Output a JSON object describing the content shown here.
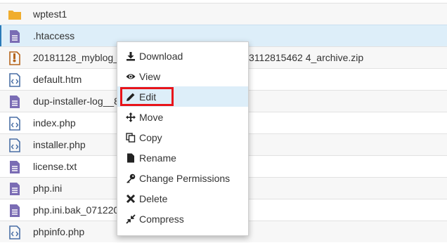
{
  "files": [
    {
      "name": "wptest1",
      "icon": "folder-icon"
    },
    {
      "name": ".htaccess",
      "icon": "text-file-icon"
    },
    {
      "name": "20181128_myblog_",
      "suffix": "3112815462 4_archive.zip",
      "icon": "zip-file-icon"
    },
    {
      "name": "default.htm",
      "icon": "code-file-icon"
    },
    {
      "name": "dup-installer-log__8",
      "icon": "text-file-icon"
    },
    {
      "name": "index.php",
      "icon": "code-file-icon"
    },
    {
      "name": "installer.php",
      "icon": "code-file-icon"
    },
    {
      "name": "license.txt",
      "icon": "text-file-icon"
    },
    {
      "name": "php.ini",
      "icon": "text-file-icon"
    },
    {
      "name": "php.ini.bak_071220",
      "icon": "text-file-icon"
    },
    {
      "name": "phpinfo.php",
      "icon": "code-file-icon"
    }
  ],
  "menu": {
    "download": "Download",
    "view": "View",
    "edit": "Edit",
    "move": "Move",
    "copy": "Copy",
    "rename": "Rename",
    "change_permissions": "Change Permissions",
    "delete": "Delete",
    "compress": "Compress"
  },
  "colors": {
    "folder": "#f0ad2e",
    "text_file": "#7a6cb4",
    "code_file": "#4a6fa5",
    "zip_file": "#b5651d",
    "highlight": "#ddeef9",
    "annotation_box": "#e8141a"
  }
}
